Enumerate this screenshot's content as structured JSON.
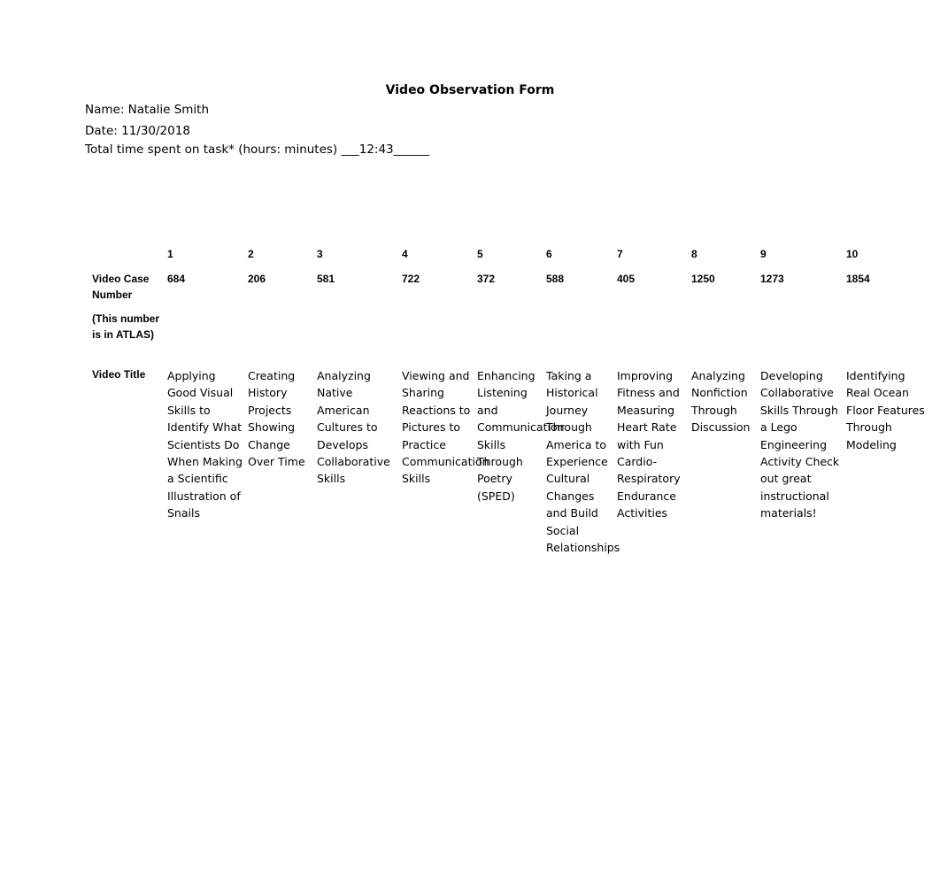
{
  "form": {
    "title": "Video Observation Form",
    "name_line": "Name: Natalie Smith",
    "date_line": "Date: 11/30/2018",
    "time_line": "Total time spent on task* (hours: minutes) ___12:43______"
  },
  "table": {
    "row_labels": {
      "case_number": "Video Case Number",
      "case_number_note": "(This number is in ATLAS)",
      "video_title": "Video Title"
    },
    "columns": [
      {
        "index": "1",
        "case_number": "684",
        "title": "Applying Good Visual Skills to Identify What Scientists Do When Making a Scientific Illustration of Snails"
      },
      {
        "index": "2",
        "case_number": "206",
        "title": "Creating History Projects Showing Change Over Time"
      },
      {
        "index": "3",
        "case_number": "581",
        "title": "Analyzing Native American Cultures to Develops Collaborative Skills"
      },
      {
        "index": "4",
        "case_number": "722",
        "title": "Viewing and Sharing Reactions to Pictures to Practice Communication Skills"
      },
      {
        "index": "5",
        "case_number": "372",
        "title": "Enhancing Listening and Communication Skills Through Poetry (SPED)"
      },
      {
        "index": "6",
        "case_number": "588",
        "title": "Taking a Historical Journey Through America to Experience Cultural Changes and Build Social Relationships"
      },
      {
        "index": "7",
        "case_number": "405",
        "title": "Improving Fitness and Measuring Heart Rate with Fun Cardio-Respiratory Endurance Activities"
      },
      {
        "index": "8",
        "case_number": "1250",
        "title": "Analyzing Nonfiction Through Discussion"
      },
      {
        "index": "9",
        "case_number": "1273",
        "title": "Developing Collaborative Skills Through a Lego Engineering Activity Check out great instructional materials!"
      },
      {
        "index": "10",
        "case_number": "1854",
        "title": "Identifying Real Ocean Floor Features Through Modeling"
      }
    ]
  }
}
